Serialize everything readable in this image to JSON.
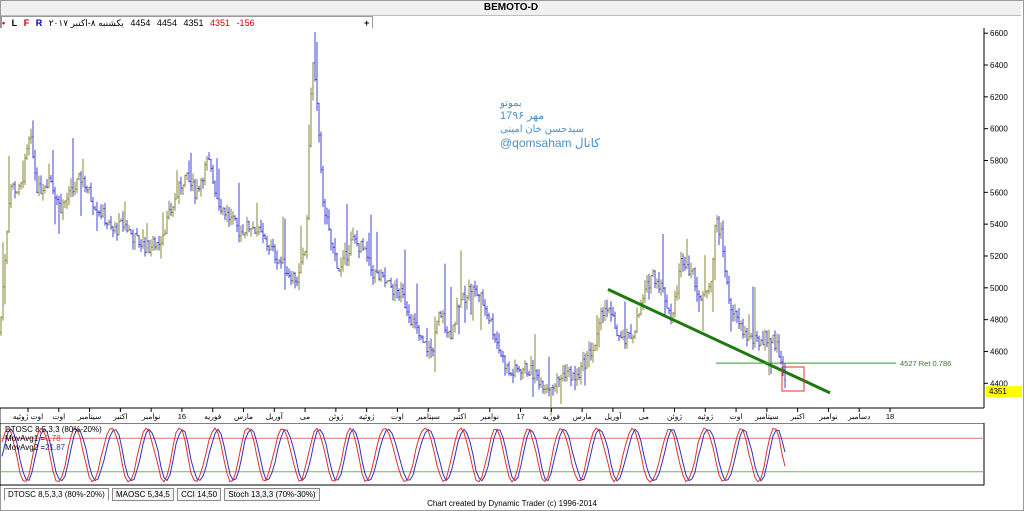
{
  "window": {
    "title": "BEMOTO-D"
  },
  "toolbar": {
    "dot": "•",
    "l": "L",
    "f": "F",
    "r": "R",
    "date": "یکشنبه ۸-اکتبر ۲۰۱۷",
    "open": "4454",
    "high": "4454",
    "low": "4351",
    "close": "4351",
    "change": "-156",
    "plus": "+"
  },
  "annotation": {
    "lines": [
      "بموتو",
      "17مهر ۹۶",
      "سیدحسن خان امینی",
      "@qomsaham کانال"
    ],
    "color": "#4a8fc9"
  },
  "price_level": {
    "label": "4527 Ret 0.786",
    "value": 4527
  },
  "last_price": {
    "label": "4351",
    "value": 4351,
    "color": "#ffff00"
  },
  "oscillator_legend": {
    "title": "DTOSC 8,5,3,3 (80%-20%)",
    "mov1_label": "MovAvg1 =",
    "mov1_value": "0.78",
    "mov2_label": "MovAvg2 =",
    "mov2_value": "21.87"
  },
  "tabs": [
    "DTOSC 8,5,3,3 (80%-20%)",
    "MAOSC 5,34,5",
    "CCI 14,50",
    "Stoch 13,3,3 (70%-30%)"
  ],
  "footer": "Chart created by Dynamic Trader  (c) 1996-2014",
  "chart_data": [
    {
      "type": "bar",
      "subtype": "ohlc-price",
      "title": "BEMOTO-D",
      "y_ticks": [
        4400,
        4600,
        4800,
        5000,
        5200,
        5400,
        5600,
        5800,
        6000,
        6200,
        6400,
        6600
      ],
      "ylim": [
        4270,
        6620
      ],
      "x_labels": [
        "اوت ژوئیه",
        "اوت",
        "سپتامبر",
        "اکتبر",
        "نوامبر",
        "16",
        "فوریه",
        "مارس",
        "آوریل",
        "می",
        "ژوئن",
        "ژوئیه",
        "اوت",
        "سپتامبر",
        "اکتبر",
        "نوامبر",
        "17",
        "فوریه",
        "مارس",
        "آوریل",
        "می",
        "ژوئن",
        "ژوئیه",
        "اوت",
        "سپتامبر",
        "اکتبر",
        "نوامبر",
        "دسامبر",
        "18"
      ],
      "price_path": [
        [
          0,
          4720
        ],
        [
          4,
          5100
        ],
        [
          10,
          5650
        ],
        [
          20,
          5600
        ],
        [
          30,
          5950
        ],
        [
          38,
          5600
        ],
        [
          50,
          5700
        ],
        [
          60,
          5500
        ],
        [
          72,
          5600
        ],
        [
          82,
          5700
        ],
        [
          92,
          5550
        ],
        [
          104,
          5450
        ],
        [
          112,
          5350
        ],
        [
          124,
          5400
        ],
        [
          136,
          5300
        ],
        [
          148,
          5250
        ],
        [
          160,
          5300
        ],
        [
          172,
          5500
        ],
        [
          184,
          5700
        ],
        [
          196,
          5600
        ],
        [
          208,
          5800
        ],
        [
          218,
          5550
        ],
        [
          228,
          5450
        ],
        [
          240,
          5350
        ],
        [
          252,
          5400
        ],
        [
          264,
          5300
        ],
        [
          276,
          5200
        ],
        [
          288,
          5100
        ],
        [
          298,
          5050
        ],
        [
          306,
          5250
        ],
        [
          312,
          6450
        ],
        [
          316,
          6250
        ],
        [
          322,
          5600
        ],
        [
          330,
          5300
        ],
        [
          340,
          5100
        ],
        [
          352,
          5300
        ],
        [
          362,
          5250
        ],
        [
          372,
          5100
        ],
        [
          382,
          5050
        ],
        [
          392,
          5000
        ],
        [
          402,
          4950
        ],
        [
          412,
          4800
        ],
        [
          422,
          4650
        ],
        [
          432,
          4600
        ],
        [
          440,
          4850
        ],
        [
          450,
          4700
        ],
        [
          460,
          4900
        ],
        [
          470,
          5000
        ],
        [
          480,
          4950
        ],
        [
          490,
          4800
        ],
        [
          500,
          4600
        ],
        [
          510,
          4450
        ],
        [
          520,
          4500
        ],
        [
          530,
          4480
        ],
        [
          540,
          4420
        ],
        [
          548,
          4380
        ],
        [
          556,
          4400
        ],
        [
          566,
          4480
        ],
        [
          576,
          4420
        ],
        [
          586,
          4550
        ],
        [
          596,
          4650
        ],
        [
          604,
          4900
        ],
        [
          612,
          4800
        ],
        [
          622,
          4650
        ],
        [
          632,
          4700
        ],
        [
          642,
          4900
        ],
        [
          652,
          5100
        ],
        [
          662,
          5000
        ],
        [
          672,
          4800
        ],
        [
          682,
          5200
        ],
        [
          692,
          5100
        ],
        [
          702,
          4900
        ],
        [
          712,
          5100
        ],
        [
          716,
          5450
        ],
        [
          722,
          5300
        ],
        [
          728,
          4950
        ],
        [
          736,
          4800
        ],
        [
          746,
          4700
        ],
        [
          756,
          4650
        ],
        [
          766,
          4700
        ],
        [
          776,
          4650
        ],
        [
          782,
          4550
        ],
        [
          786,
          4351
        ]
      ],
      "trendline": {
        "start": [
          608,
          4990
        ],
        "end": [
          830,
          4340
        ],
        "color": "#1d7a0f"
      },
      "colors": {
        "up": "#8a8a3a",
        "down": "#4545d9"
      }
    },
    {
      "type": "line",
      "title": "DTOSC 8,5,3,3 (80%-20%)",
      "ylim": [
        0,
        100
      ],
      "levels": [
        80,
        20
      ],
      "series": [
        {
          "name": "MovAvg1",
          "color": "#e03030"
        },
        {
          "name": "MovAvg2",
          "color": "#3030c0"
        }
      ]
    }
  ]
}
